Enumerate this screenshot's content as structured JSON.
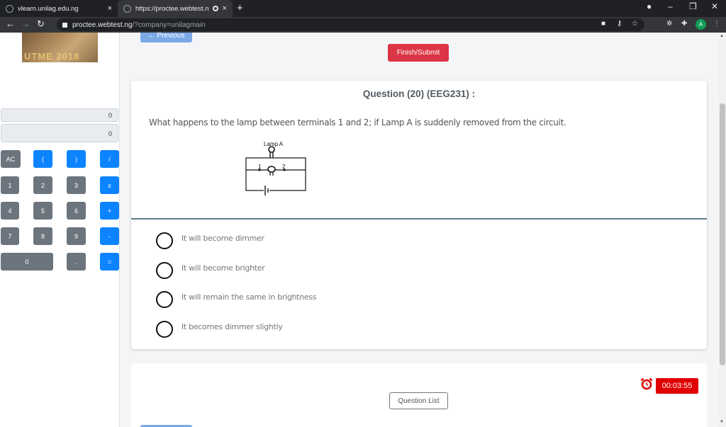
{
  "browser": {
    "tabs": [
      {
        "title": "vlearn.unilag.edu.ng",
        "close": "×"
      },
      {
        "title": "https://proctee.webtest.ng/",
        "close": "×"
      }
    ],
    "new_tab": "+",
    "url_host": "proctee.webtest.ng",
    "url_path": "/?company=unilagmain",
    "profile_initial": "A"
  },
  "webcam": {
    "overlay_text": "UTME 2018"
  },
  "calculator": {
    "display_top": "0",
    "display_bottom": "0",
    "rows": [
      [
        "AC",
        "(",
        ")",
        "/"
      ],
      [
        "1",
        "2",
        "3",
        "x"
      ],
      [
        "4",
        "5",
        "6",
        "+"
      ],
      [
        "7",
        "8",
        "9",
        "-"
      ],
      [
        "0",
        ".",
        "="
      ]
    ]
  },
  "nav": {
    "previous_label": "← Previous",
    "finish_label": "Finish/Submit"
  },
  "question": {
    "title": "Question (20) (EEG231) :",
    "text": "What happens to the lamp between terminals 1 and 2; if Lamp A is suddenly removed from the circuit.",
    "diagram_labels": {
      "lamp": "Lamp A",
      "t1": "1",
      "t2": "2"
    },
    "options": [
      "It will become dimmer",
      "It will become brighter",
      "It will remain the same in brightness",
      "It becomes dimmer slightly"
    ]
  },
  "footer": {
    "timer": "00:03:55",
    "question_list_label": "Question List"
  },
  "colors": {
    "primary": "#0d84ff",
    "danger": "#dc3545",
    "timer_red": "#e00000",
    "secondary": "#6c757d"
  }
}
